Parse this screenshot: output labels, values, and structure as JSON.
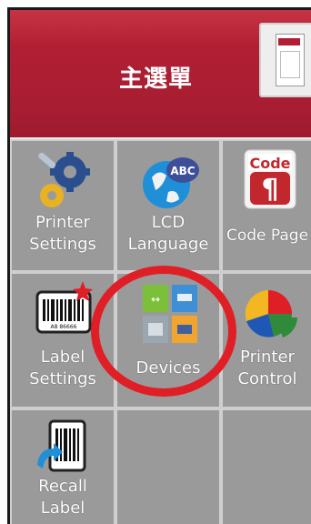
{
  "header": {
    "title": "主選單"
  },
  "menu": [
    {
      "label": "Printer\nSettings",
      "icon": "gears-icon"
    },
    {
      "label": "LCD\nLanguage",
      "icon": "globe-abc-icon"
    },
    {
      "label": "Code Page",
      "icon": "code-page-icon"
    },
    {
      "label": "Label\nSettings",
      "icon": "barcode-label-icon"
    },
    {
      "label": "Devices",
      "icon": "devices-icon"
    },
    {
      "label": "Printer\nControl",
      "icon": "pie-chart-icon"
    },
    {
      "label": "Recall\nLabel",
      "icon": "recall-barcode-icon"
    }
  ],
  "colors": {
    "header": "#a71d32",
    "tile": "#9a9a9a",
    "highlight": "#e01e26"
  }
}
